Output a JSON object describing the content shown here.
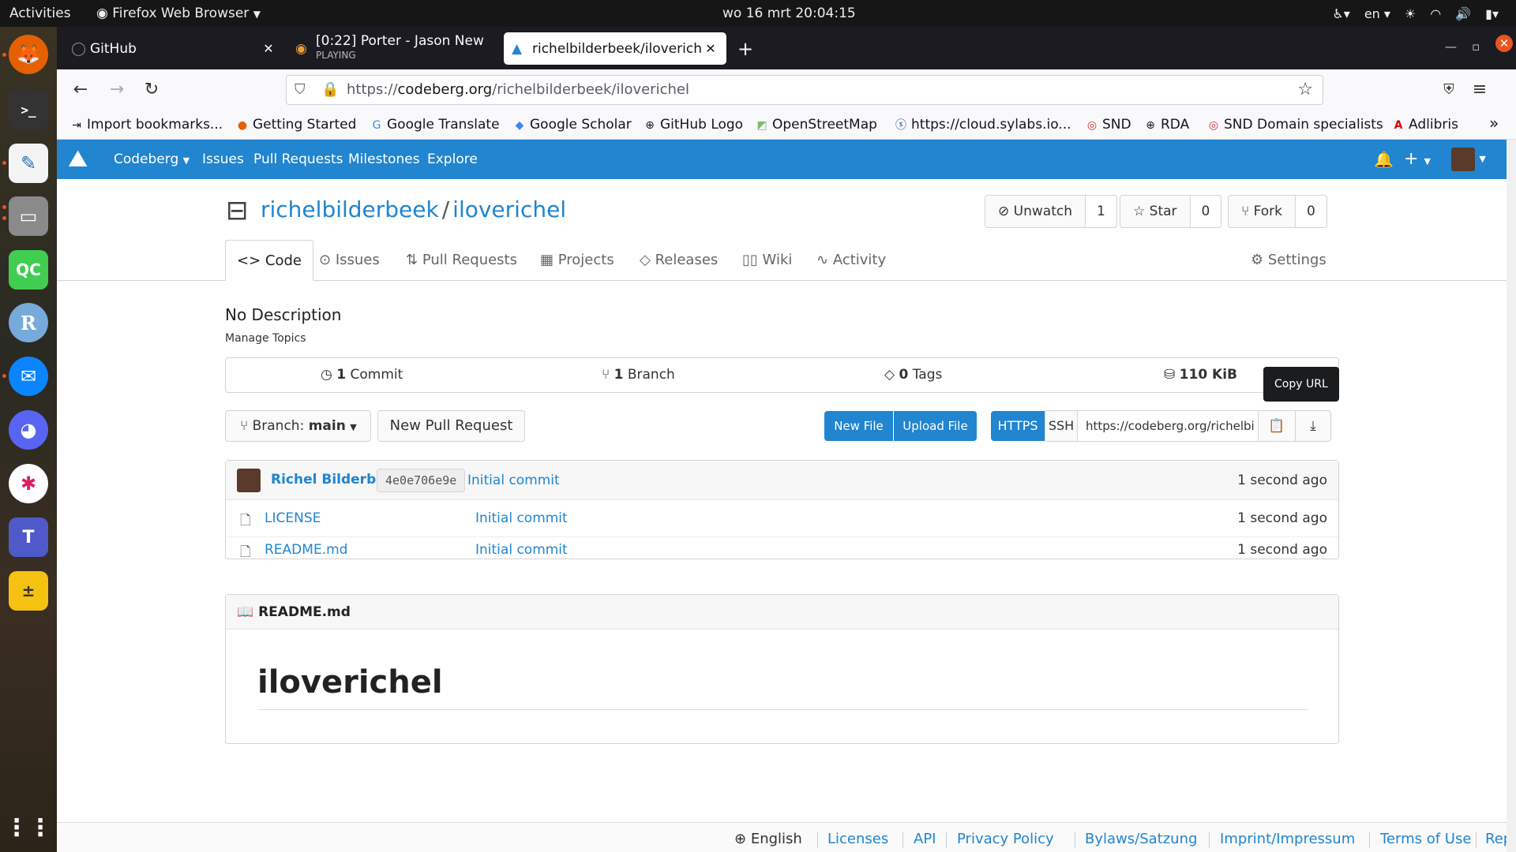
{
  "system": {
    "activities": "Activities",
    "app_menu": "Firefox Web Browser",
    "clock": "wo 16 mrt  20:04:15",
    "lang": "en"
  },
  "tabs": [
    {
      "title": "GitHub"
    },
    {
      "title": "[0:22] Porter - Jason New",
      "subtitle": "PLAYING"
    },
    {
      "title": "richelbilderbeek/iloverich"
    }
  ],
  "urlbar": {
    "scheme": "https://",
    "domain": "codeberg.org",
    "path": "/richelbilderbeek/iloverichel"
  },
  "bookmarks": [
    "Import bookmarks...",
    "Getting Started",
    "Google Translate",
    "Google Scholar",
    "GitHub Logo",
    "OpenStreetMap",
    "https://cloud.sylabs.io...",
    "SND",
    "RDA",
    "SND Domain specialists",
    "Adlibris"
  ],
  "nav": {
    "brand": "Codeberg",
    "issues": "Issues",
    "pulls": "Pull Requests",
    "milestones": "Milestones",
    "explore": "Explore"
  },
  "repo": {
    "owner": "richelbilderbeek",
    "name": "iloverichel",
    "unwatch": "Unwatch",
    "watch_count": "1",
    "star": "Star",
    "star_count": "0",
    "fork": "Fork",
    "fork_count": "0"
  },
  "repo_tabs": {
    "code": "Code",
    "issues": "Issues",
    "pulls": "Pull Requests",
    "projects": "Projects",
    "releases": "Releases",
    "wiki": "Wiki",
    "activity": "Activity",
    "settings": "Settings"
  },
  "description": "No Description",
  "manage_topics": "Manage Topics",
  "stats": {
    "commits_n": "1",
    "commits_label": "Commit",
    "branches_n": "1",
    "branches_label": "Branch",
    "tags_n": "0",
    "tags_label": "Tags",
    "size": "110 KiB"
  },
  "tooltip": "Copy URL",
  "actions": {
    "branch_prefix": "Branch:",
    "branch": "main",
    "new_pr": "New Pull Request",
    "new_file": "New File",
    "upload_file": "Upload File",
    "https": "HTTPS",
    "ssh": "SSH",
    "clone_url": "https://codeberg.org/richelbi"
  },
  "latest_commit": {
    "author": "Richel Bilderbeek",
    "sha": "4e0e706e9e",
    "message": "Initial commit",
    "time": "1 second ago"
  },
  "files": [
    {
      "name": "LICENSE",
      "commit": "Initial commit",
      "time": "1 second ago"
    },
    {
      "name": "README.md",
      "commit": "Initial commit",
      "time": "1 second ago"
    }
  ],
  "readme": {
    "filename": "README.md",
    "heading": "iloverichel"
  },
  "footer": [
    "English",
    "Licenses",
    "API",
    "Privacy Policy",
    "Bylaws/Satzung",
    "Imprint/Impressum",
    "Terms of Use",
    "Report Abuse"
  ],
  "colors": {
    "accent": "#2185d0",
    "topbar": "#161616",
    "tabbar": "#1c1b22"
  }
}
